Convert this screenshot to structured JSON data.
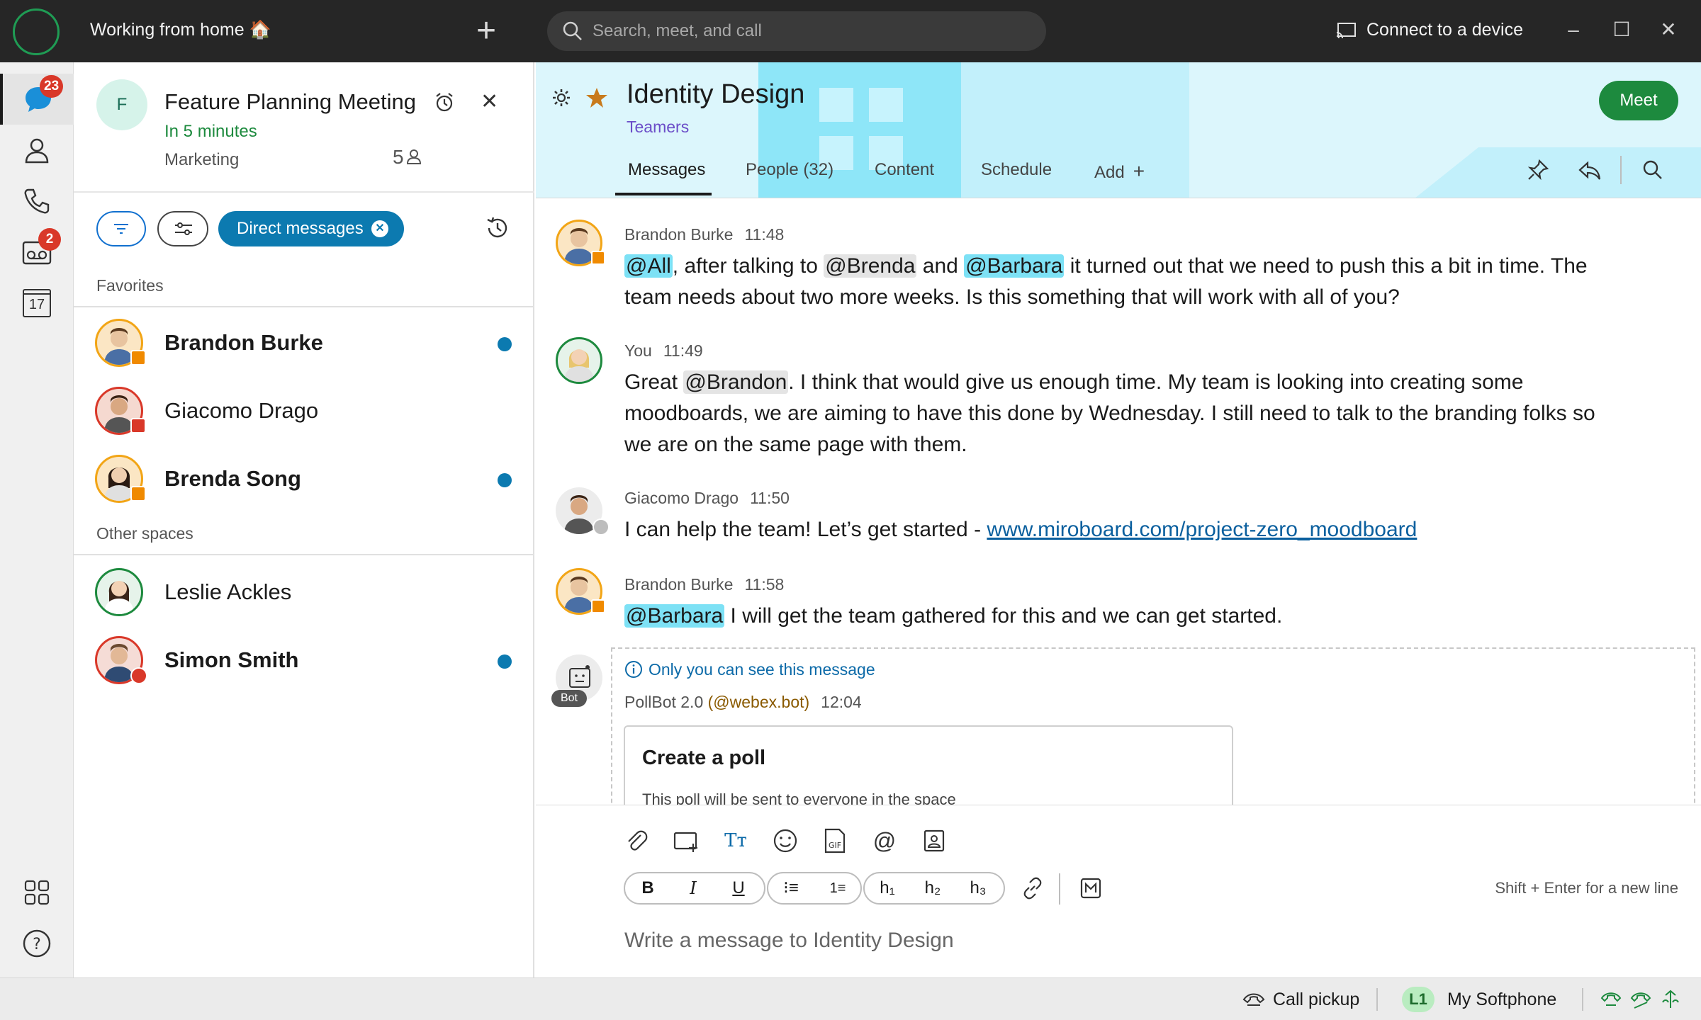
{
  "titlebar": {
    "status": "Working from home 🏠",
    "search_placeholder": "Search, meet, and call",
    "connect_device": "Connect to a device"
  },
  "rail": {
    "messaging_badge": "23",
    "voicemail_badge": "2",
    "calendar_day": "17"
  },
  "meeting": {
    "avatar_letter": "F",
    "title": "Feature Planning Meeting",
    "starts": "In 5 minutes",
    "team": "Marketing",
    "participants": "5"
  },
  "filters": {
    "direct_messages": "Direct messages"
  },
  "sections": {
    "favorites": "Favorites",
    "other_spaces": "Other spaces"
  },
  "favorites": [
    {
      "name": "Brandon Burke",
      "bold": true,
      "unread": true
    },
    {
      "name": "Giacomo Drago",
      "bold": false,
      "unread": false
    },
    {
      "name": "Brenda Song",
      "bold": true,
      "unread": true
    }
  ],
  "others": [
    {
      "name": "Leslie Ackles",
      "bold": false,
      "unread": false
    },
    {
      "name": "Simon Smith",
      "bold": true,
      "unread": true
    }
  ],
  "space": {
    "title": "Identity Design",
    "team": "Teamers",
    "meet_label": "Meet",
    "tabs": [
      "Messages",
      "People (32)",
      "Content",
      "Schedule",
      "Add"
    ]
  },
  "messages": [
    {
      "author": "Brandon Burke",
      "time": "11:48",
      "m1": "@All",
      "t1": ", after talking to ",
      "m2": "@Brenda",
      "t2": " and ",
      "m3": "@Barbara",
      "t3": " it turned out that we need to push this a bit in time. The team needs about two more weeks. Is this something that will work with all of you?"
    },
    {
      "author": "You",
      "time": "11:49",
      "t0": "Great ",
      "m1": "@Brandon",
      "t1": ". I think that would give us enough time. My team is looking into creating some moodboards, we are aiming to have this done by Wednesday. I still need to talk to the branding folks so we are on the same page with them."
    },
    {
      "author": "Giacomo Drago",
      "time": "11:50",
      "t0": "I can help the team! Let’s get started - ",
      "link": "www.miroboard.com/project-zero_moodboard"
    },
    {
      "author": "Brandon Burke",
      "time": "11:58",
      "m1": "@Barbara",
      "t1": " I will get the team gathered for this and we can get started."
    }
  ],
  "bot": {
    "notice": "Only you can see this message",
    "name": "PollBot 2.0",
    "handle": "(@webex.bot)",
    "time": "12:04",
    "tag": "Bot",
    "card_title": "Create a poll",
    "card_sub": "This poll will be sent to everyone in the space"
  },
  "composer": {
    "hint": "Shift + Enter for a new line",
    "placeholder": "Write a message to Identity Design"
  },
  "statusbar": {
    "call_pickup": "Call pickup",
    "line": "L1",
    "softphone": "My Softphone"
  }
}
